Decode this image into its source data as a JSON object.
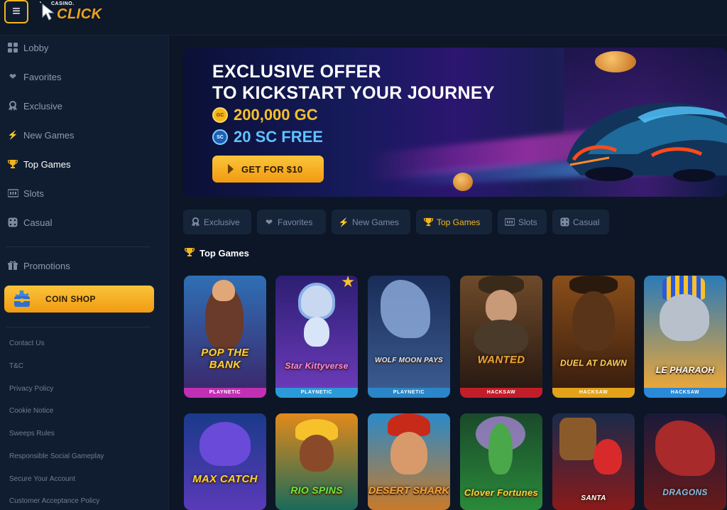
{
  "header": {
    "menu_icon": "hamburger-icon",
    "logo_small": "CASINO.",
    "logo_big": "CLICK"
  },
  "sidebar": {
    "items": [
      {
        "label": "Lobby",
        "icon": "grid-icon"
      },
      {
        "label": "Favorites",
        "icon": "heart-icon"
      },
      {
        "label": "Exclusive",
        "icon": "badge-icon"
      },
      {
        "label": "New Games",
        "icon": "lightning-icon"
      },
      {
        "label": "Top Games",
        "icon": "trophy-icon",
        "active": true
      },
      {
        "label": "Slots",
        "icon": "slots-icon"
      },
      {
        "label": "Casual",
        "icon": "dice-icon"
      }
    ],
    "promotions": "Promotions",
    "coin_shop": "COIN SHOP",
    "footer_links": [
      "Contact Us",
      "T&C",
      "Privacy Policy",
      "Cookie Notice",
      "Sweeps Rules",
      "Responsible Social Gameplay",
      "Secure Your Account",
      "Customer Acceptance Policy"
    ]
  },
  "banner": {
    "line1": "EXCLUSIVE OFFER",
    "line2": "TO KICKSTART YOUR JOURNEY",
    "gc_badge": "GC",
    "gc_amount": "200,000 GC",
    "sc_badge": "SC",
    "sc_amount": "20 SC FREE",
    "cta": "GET FOR $10"
  },
  "tabs": [
    {
      "label": "Exclusive",
      "icon": "badge-icon"
    },
    {
      "label": "Favorites",
      "icon": "heart-icon"
    },
    {
      "label": "New Games",
      "icon": "lightning-icon"
    },
    {
      "label": "Top Games",
      "icon": "trophy-icon",
      "active": true
    },
    {
      "label": "Slots",
      "icon": "slots-icon"
    },
    {
      "label": "Casual",
      "icon": "dice-icon"
    }
  ],
  "section": {
    "title": "Top Games",
    "icon": "trophy-icon"
  },
  "colors": {
    "accent": "#f3b71c",
    "background": "#0c1626",
    "sidebar": "#101d30"
  },
  "games_row1": [
    {
      "title": "POP THE BANK",
      "provider": "PLAYNETIC",
      "bar": "#c12fb4",
      "bg1": "#2f6fb5",
      "bg2": "#3a2a6e"
    },
    {
      "title": "Star Kittyverse",
      "provider": "PLAYNETIC",
      "bar": "#2a9ad8",
      "bg1": "#2c1e72",
      "bg2": "#6a3ab8"
    },
    {
      "title": "WOLF MOON PAYS",
      "provider": "PLAYNETIC",
      "bar": "#2a86c8",
      "bg1": "#1a2c58",
      "bg2": "#3a5a8e"
    },
    {
      "title": "WANTED",
      "provider": "HACKSAW",
      "bar": "#c21e2a",
      "bg1": "#6e4a2a",
      "bg2": "#2a1a12"
    },
    {
      "title": "DUEL AT DAWN",
      "provider": "HACKSAW",
      "bar": "#e2a21a",
      "bg1": "#8a4e1a",
      "bg2": "#3a1e0e"
    },
    {
      "title": "LE PHARAOH",
      "provider": "HACKSAW",
      "bar": "#2a8ad8",
      "bg1": "#2a7ab8",
      "bg2": "#e8a63a"
    }
  ],
  "games_row2": [
    {
      "title": "MAX CATCH",
      "bg1": "#1a3a8a",
      "bg2": "#5a3ab8"
    },
    {
      "title": "RIO SPINS",
      "bg1": "#e28a1a",
      "bg2": "#1a6a5a"
    },
    {
      "title": "DESERT SHARK",
      "bg1": "#2a8ac8",
      "bg2": "#c87a2a"
    },
    {
      "title": "Clover Fortunes",
      "bg1": "#1a4a2a",
      "bg2": "#2a8a3a"
    },
    {
      "title": "SANTA",
      "bg1": "#1a2a4a",
      "bg2": "#8a1a1a"
    },
    {
      "title": "DRAGONS",
      "bg1": "#1a1a3a",
      "bg2": "#6a1a1a"
    }
  ]
}
